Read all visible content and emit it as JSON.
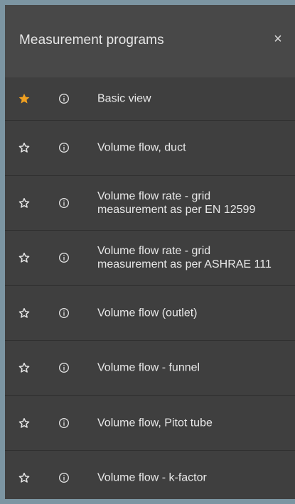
{
  "header": {
    "title": "Measurement programs",
    "close_icon": "close-icon",
    "close_glyph": "×"
  },
  "colors": {
    "accent": "#f0a020",
    "panel": "#3d3d3d",
    "text": "#e8e8e8"
  },
  "items": [
    {
      "label": "Basic view",
      "favorite": true
    },
    {
      "label": "Volume flow, duct",
      "favorite": false
    },
    {
      "label": "Volume flow rate - grid\nmeasurement as per EN 12599",
      "favorite": false
    },
    {
      "label": "Volume flow rate - grid\nmeasurement as per ASHRAE 111",
      "favorite": false
    },
    {
      "label": "Volume flow (outlet)",
      "favorite": false
    },
    {
      "label": "Volume flow - funnel",
      "favorite": false
    },
    {
      "label": "Volume flow, Pitot tube",
      "favorite": false
    },
    {
      "label": "Volume flow - k-factor",
      "favorite": false
    }
  ]
}
